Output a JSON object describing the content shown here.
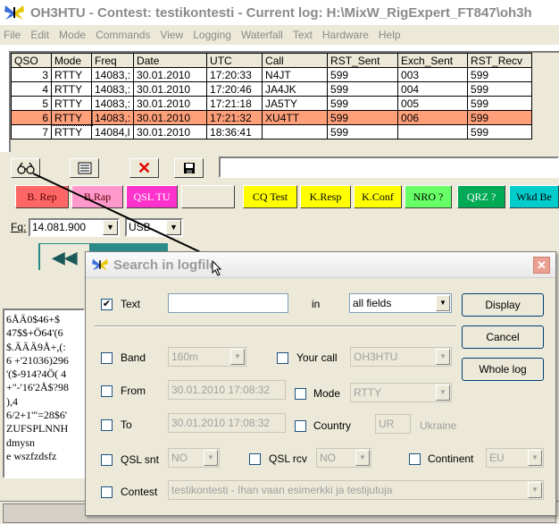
{
  "window": {
    "title": "OH3HTU - Contest: testikontesti - Current log: H:\\MixW_RigExpert_FT847\\oh3h"
  },
  "menu": [
    "File",
    "Edit",
    "Mode",
    "Commands",
    "View",
    "Logging",
    "Waterfall",
    "Text",
    "Hardware",
    "Help"
  ],
  "log_table": {
    "columns": [
      "QSO",
      "Mode",
      "Freq",
      "Date",
      "UTC",
      "Call",
      "RST_Sent",
      "Exch_Sent",
      "RST_Recv"
    ],
    "rows": [
      [
        "3",
        "RTTY",
        "14083,:",
        "30.01.2010",
        "17:20:33",
        "N4JT",
        "599",
        "003",
        "599"
      ],
      [
        "4",
        "RTTY",
        "14083,:",
        "30.01.2010",
        "17:20:46",
        "JA4JK",
        "599",
        "004",
        "599"
      ],
      [
        "5",
        "RTTY",
        "14083,:",
        "30.01.2010",
        "17:21:18",
        "JA5TY",
        "599",
        "005",
        "599"
      ],
      [
        "6",
        "RTTY",
        "14083,:",
        "30.01.2010",
        "17:21:32",
        "XU4TT",
        "599",
        "006",
        "599"
      ],
      [
        "7",
        "RTTY",
        "14084,l",
        "30.01.2010",
        "18:36:41",
        "",
        "599",
        "",
        "599"
      ]
    ],
    "selected_row": 3
  },
  "toolbar": {
    "search_icon": "binoculars-icon",
    "edit_icon": "edit-icon",
    "delete_icon": "x-icon",
    "save_icon": "floppy-icon"
  },
  "macros": [
    {
      "label": "B. Rep",
      "color": "#ff6666"
    },
    {
      "label": "B.Rap",
      "color": "#ff99cc"
    },
    {
      "label": "QSL TU",
      "color": "#ff33cc"
    },
    {
      "label": "",
      "color": "#ece9d8"
    },
    {
      "label": "CQ Test",
      "color": "#ffff00"
    },
    {
      "label": "K.Resp",
      "color": "#ffff00"
    },
    {
      "label": "K.Conf",
      "color": "#ffff00"
    },
    {
      "label": "NRO ?",
      "color": "#66ff66"
    },
    {
      "label": "QRZ ?",
      "color": "#00aa55"
    },
    {
      "label": "Wkd Be",
      "color": "#00cccc"
    }
  ],
  "freq": {
    "label": "Fq:",
    "value": "14.081.900",
    "mode": "USB"
  },
  "rx_text": [
    "6ÅÄ0$46+$",
    "47$$+Ö64'(6",
    "$.ÄÄÄ9Å+,(:",
    "6 +'21036)296",
    "'($-914?4Ö( 4",
    "+\"-'16'2Å$?98",
    "),4",
    "6/2+1'\"=28$6'",
    "ZUFSPLNNH",
    "dmysn",
    "e wszfzdsfz"
  ],
  "dialog": {
    "title": "Search in logfile",
    "text_label": "Text",
    "text_value": "",
    "in_label": "in",
    "in_value": "all fields",
    "band_label": "Band",
    "band_value": "160m",
    "yourcall_label": "Your call",
    "yourcall_value": "OH3HTU",
    "from_label": "From",
    "from_value": "30.01.2010 17:08:32",
    "mode_label": "Mode",
    "mode_value": "RTTY",
    "to_label": "To",
    "to_value": "30.01.2010 17:08:32",
    "country_label": "Country",
    "country_value": "UR",
    "country_name": "Ukraine",
    "qslsnt_label": "QSL snt",
    "qslsnt_value": "NO",
    "qslrcv_label": "QSL rcv",
    "qslrcv_value": "NO",
    "continent_label": "Continent",
    "continent_value": "EU",
    "contest_label": "Contest",
    "contest_value": "testikontesti - Ihan vaan esimerkki ja testijutuja",
    "buttons": {
      "display": "Display",
      "cancel": "Cancel",
      "whole_log": "Whole log"
    },
    "text_checked": "✔"
  }
}
